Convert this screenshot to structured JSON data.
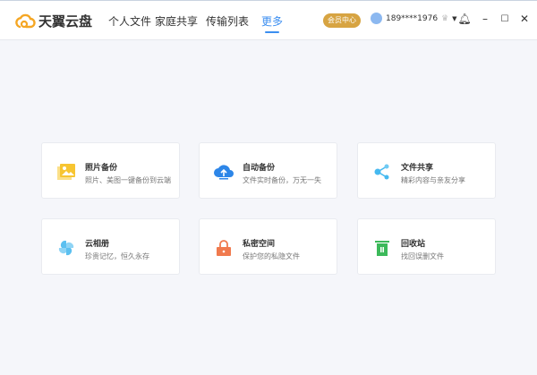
{
  "app": {
    "name": "天翼云盘"
  },
  "nav": [
    {
      "label": "个人文件"
    },
    {
      "label": "家庭共享"
    },
    {
      "label": "传输列表"
    },
    {
      "label": "更多",
      "active": true
    }
  ],
  "header": {
    "vip_label": "会员中心",
    "username": "189****1976"
  },
  "cards": [
    {
      "title": "照片备份",
      "subtitle": "照片、美图一键备份到云端",
      "icon": "photo-icon",
      "color": "#f7c531"
    },
    {
      "title": "自动备份",
      "subtitle": "文件实时备份，万无一失",
      "icon": "cloud-upload-icon",
      "color": "#2d86e8"
    },
    {
      "title": "文件共享",
      "subtitle": "精彩内容与亲友分享",
      "icon": "share-icon",
      "color": "#45b9f0"
    },
    {
      "title": "云相册",
      "subtitle": "珍贵记忆，恒久永存",
      "icon": "pinwheel-icon",
      "color": "#5cc0f0"
    },
    {
      "title": "私密空间",
      "subtitle": "保护您的私隐文件",
      "icon": "lock-icon",
      "color": "#f07a4e"
    },
    {
      "title": "回收站",
      "subtitle": "找回误删文件",
      "icon": "trash-icon",
      "color": "#3cb95a"
    }
  ]
}
